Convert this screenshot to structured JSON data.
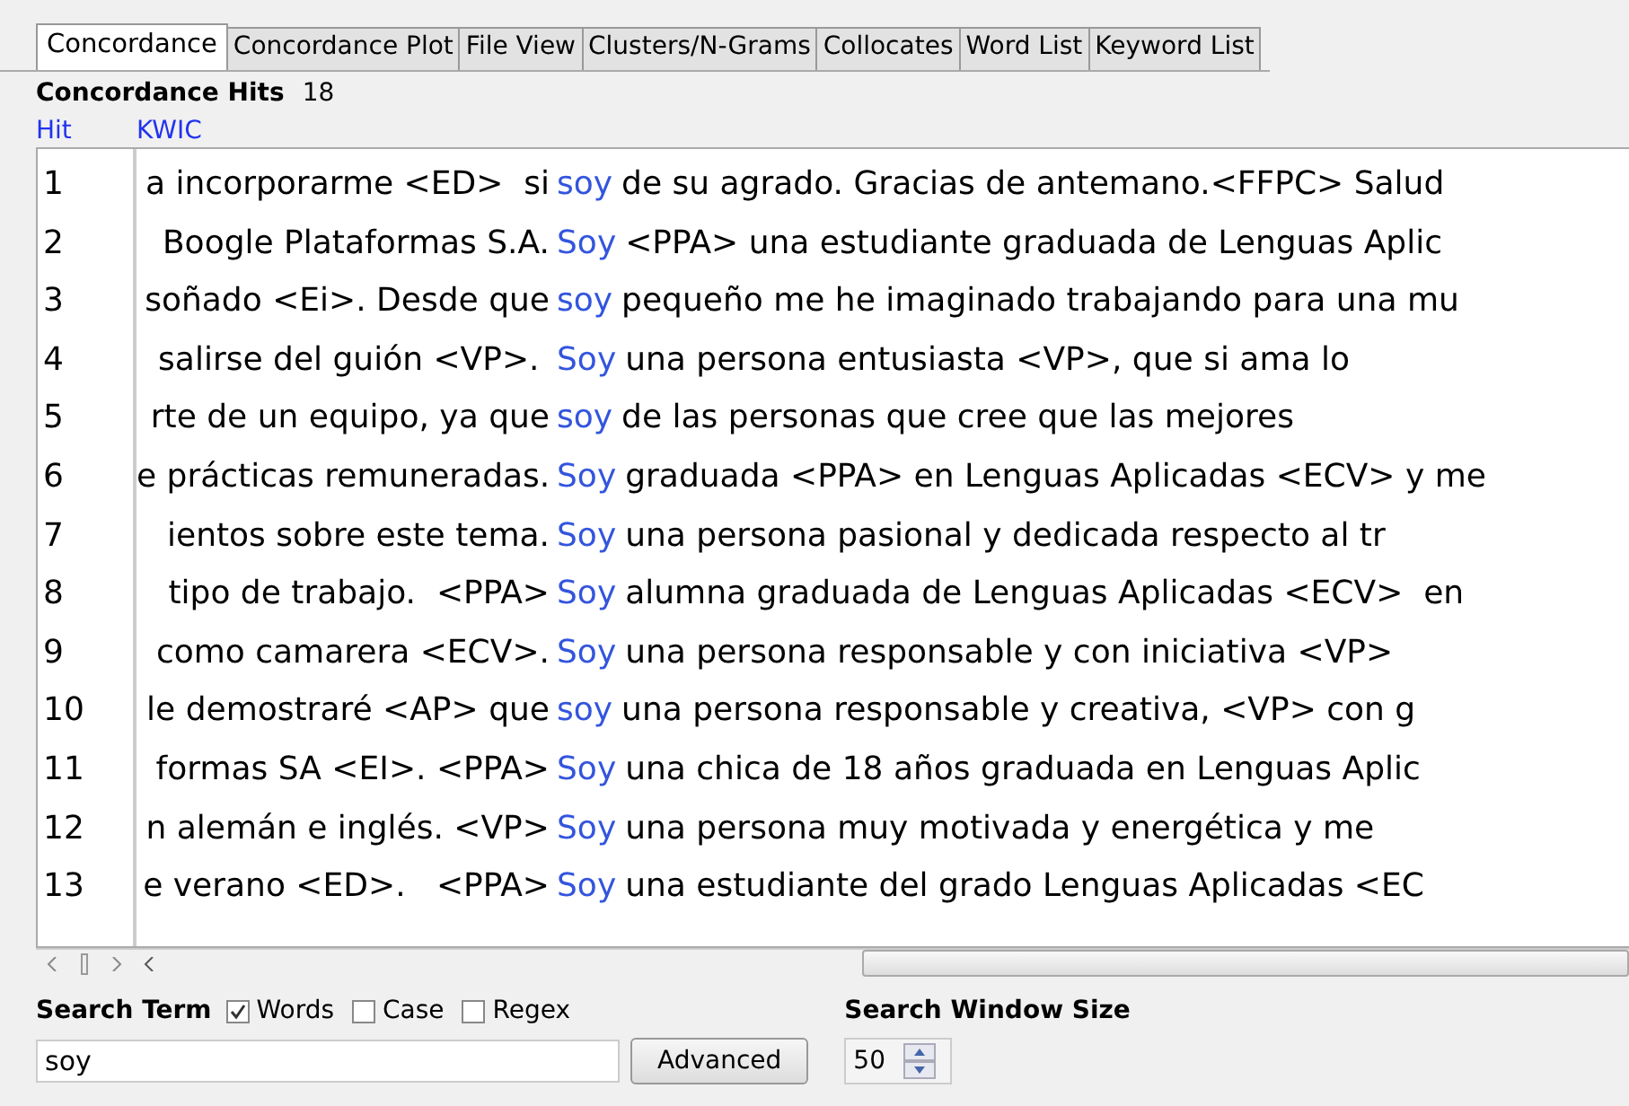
{
  "tabs": [
    {
      "label": "Concordance",
      "selected": true
    },
    {
      "label": "Concordance Plot",
      "selected": false
    },
    {
      "label": "File View",
      "selected": false
    },
    {
      "label": "Clusters/N-Grams",
      "selected": false
    },
    {
      "label": "Collocates",
      "selected": false
    },
    {
      "label": "Word List",
      "selected": false
    },
    {
      "label": "Keyword List",
      "selected": false
    }
  ],
  "hits": {
    "label": "Concordance Hits",
    "count": "18"
  },
  "table": {
    "columns": [
      "Hit",
      "KWIC"
    ],
    "rows": [
      {
        "hit": "1",
        "left": "a incorporarme <ED>  si",
        "keyword": "soy",
        "right": "de su agrado. Gracias de antemano.<FFPC> Salud"
      },
      {
        "hit": "2",
        "left": "Boogle Plataformas S.A.",
        "keyword": "Soy",
        "right": "<PPA> una estudiante graduada de Lenguas Aplic"
      },
      {
        "hit": "3",
        "left": "soñado <Ei>. Desde que",
        "keyword": "soy",
        "right": "pequeño me he imaginado trabajando para una mu"
      },
      {
        "hit": "4",
        "left": "salirse del guión <VP>. ",
        "keyword": "Soy",
        "right": "una persona entusiasta <VP>, que si ama lo"
      },
      {
        "hit": "5",
        "left": "rte de un equipo, ya que",
        "keyword": "soy",
        "right": "de las personas que cree que las mejores"
      },
      {
        "hit": "6",
        "left": "e prácticas remuneradas.",
        "keyword": "Soy",
        "right": "graduada <PPA> en Lenguas Aplicadas <ECV> y me"
      },
      {
        "hit": "7",
        "left": "ientos sobre este tema.",
        "keyword": "Soy",
        "right": "una persona pasional y dedicada respecto al tr"
      },
      {
        "hit": "8",
        "left": "tipo de trabajo.  <PPA>",
        "keyword": "Soy",
        "right": "alumna graduada de Lenguas Aplicadas <ECV>  en"
      },
      {
        "hit": "9",
        "left": "como camarera <ECV>.",
        "keyword": "Soy",
        "right": "una persona responsable y con iniciativa <VP>"
      },
      {
        "hit": "10",
        "left": "le demostraré <AP> que",
        "keyword": "soy",
        "right": "una persona responsable y creativa, <VP> con g"
      },
      {
        "hit": "11",
        "left": "formas SA <EI>. <PPA>",
        "keyword": "Soy",
        "right": "una chica de 18 años graduada en Lenguas Aplic"
      },
      {
        "hit": "12",
        "left": "n alemán e inglés. <VP>",
        "keyword": "Soy",
        "right": "una persona muy motivada y energética y me"
      },
      {
        "hit": "13",
        "left": "e verano <ED>.   <PPA>",
        "keyword": "Soy",
        "right": "una estudiante del grado Lenguas Aplicadas <EC"
      }
    ]
  },
  "search": {
    "label": "Search Term",
    "options": [
      {
        "label": "Words",
        "checked": true
      },
      {
        "label": "Case",
        "checked": false
      },
      {
        "label": "Regex",
        "checked": false
      }
    ],
    "value": "soy",
    "advanced": "Advanced",
    "window_label": "Search Window Size",
    "window_size": "50"
  }
}
